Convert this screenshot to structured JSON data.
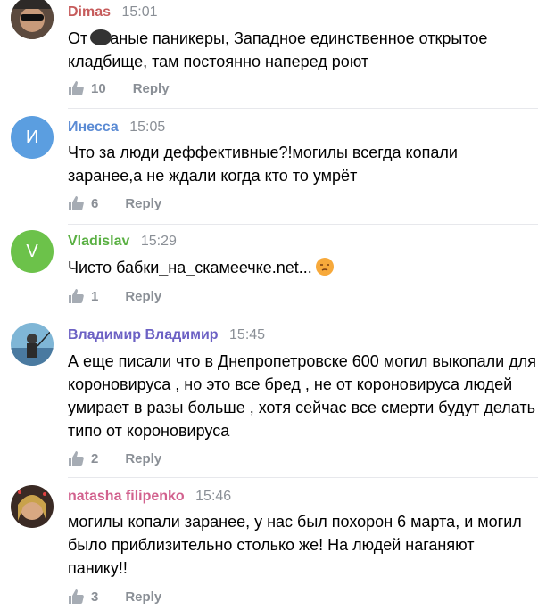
{
  "comments": [
    {
      "author": "Dimas",
      "author_color": "#c65b5b",
      "time": "15:01",
      "text_before": "От ",
      "text_after": "аные паникеры, Западное единственное открытое кладбище, там постоянно наперед роют",
      "likes": "10",
      "reply": "Reply",
      "avatar_type": "photo"
    },
    {
      "author": "Инесса",
      "author_color": "#5b8bd4",
      "time": "15:05",
      "text": "Что за люди деффективные?!могилы всегда копали заранее,а не ждали когда кто то умрёт",
      "likes": "6",
      "reply": "Reply",
      "avatar_letter": "И",
      "avatar_color": "#5b9ee0"
    },
    {
      "author": "Vladislav",
      "author_color": "#5ab043",
      "time": "15:29",
      "text": "Чисто бабки_на_скамеечке.net...",
      "emoji": "unamused-face-emoji",
      "likes": "1",
      "reply": "Reply",
      "avatar_letter": "V",
      "avatar_color": "#6cc24a"
    },
    {
      "author": "Владимир Владимир",
      "author_color": "#6c61c4",
      "time": "15:45",
      "text": "А еще писали что в Днепропетровске 600 могил выкопали для короновируса , но это все бред , не от короновируса людей умирает в разы больше , хотя сейчас все смерти будут делать типо от короновируса",
      "likes": "2",
      "reply": "Reply",
      "avatar_type": "photo"
    },
    {
      "author": "natasha filipenko",
      "author_color": "#d2618e",
      "time": "15:46",
      "text": "могилы копали заранее, у нас был похорон 6 марта, и могил было приблизительно столько же! На людей наганяют панику!!",
      "likes": "3",
      "reply": "Reply",
      "avatar_type": "photo"
    }
  ]
}
